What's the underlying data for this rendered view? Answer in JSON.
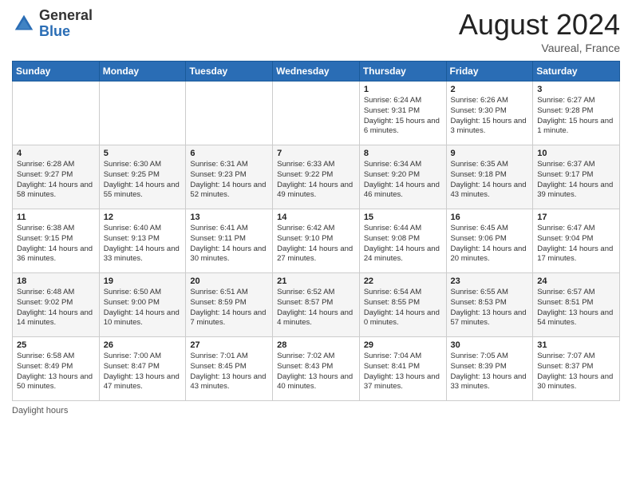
{
  "header": {
    "logo": {
      "general": "General",
      "blue": "Blue"
    },
    "title": "August 2024",
    "location": "Vaureal, France"
  },
  "calendar": {
    "days_of_week": [
      "Sunday",
      "Monday",
      "Tuesday",
      "Wednesday",
      "Thursday",
      "Friday",
      "Saturday"
    ],
    "weeks": [
      [
        {
          "day": "",
          "info": ""
        },
        {
          "day": "",
          "info": ""
        },
        {
          "day": "",
          "info": ""
        },
        {
          "day": "",
          "info": ""
        },
        {
          "day": "1",
          "info": "Sunrise: 6:24 AM\nSunset: 9:31 PM\nDaylight: 15 hours and 6 minutes."
        },
        {
          "day": "2",
          "info": "Sunrise: 6:26 AM\nSunset: 9:30 PM\nDaylight: 15 hours and 3 minutes."
        },
        {
          "day": "3",
          "info": "Sunrise: 6:27 AM\nSunset: 9:28 PM\nDaylight: 15 hours and 1 minute."
        }
      ],
      [
        {
          "day": "4",
          "info": "Sunrise: 6:28 AM\nSunset: 9:27 PM\nDaylight: 14 hours and 58 minutes."
        },
        {
          "day": "5",
          "info": "Sunrise: 6:30 AM\nSunset: 9:25 PM\nDaylight: 14 hours and 55 minutes."
        },
        {
          "day": "6",
          "info": "Sunrise: 6:31 AM\nSunset: 9:23 PM\nDaylight: 14 hours and 52 minutes."
        },
        {
          "day": "7",
          "info": "Sunrise: 6:33 AM\nSunset: 9:22 PM\nDaylight: 14 hours and 49 minutes."
        },
        {
          "day": "8",
          "info": "Sunrise: 6:34 AM\nSunset: 9:20 PM\nDaylight: 14 hours and 46 minutes."
        },
        {
          "day": "9",
          "info": "Sunrise: 6:35 AM\nSunset: 9:18 PM\nDaylight: 14 hours and 43 minutes."
        },
        {
          "day": "10",
          "info": "Sunrise: 6:37 AM\nSunset: 9:17 PM\nDaylight: 14 hours and 39 minutes."
        }
      ],
      [
        {
          "day": "11",
          "info": "Sunrise: 6:38 AM\nSunset: 9:15 PM\nDaylight: 14 hours and 36 minutes."
        },
        {
          "day": "12",
          "info": "Sunrise: 6:40 AM\nSunset: 9:13 PM\nDaylight: 14 hours and 33 minutes."
        },
        {
          "day": "13",
          "info": "Sunrise: 6:41 AM\nSunset: 9:11 PM\nDaylight: 14 hours and 30 minutes."
        },
        {
          "day": "14",
          "info": "Sunrise: 6:42 AM\nSunset: 9:10 PM\nDaylight: 14 hours and 27 minutes."
        },
        {
          "day": "15",
          "info": "Sunrise: 6:44 AM\nSunset: 9:08 PM\nDaylight: 14 hours and 24 minutes."
        },
        {
          "day": "16",
          "info": "Sunrise: 6:45 AM\nSunset: 9:06 PM\nDaylight: 14 hours and 20 minutes."
        },
        {
          "day": "17",
          "info": "Sunrise: 6:47 AM\nSunset: 9:04 PM\nDaylight: 14 hours and 17 minutes."
        }
      ],
      [
        {
          "day": "18",
          "info": "Sunrise: 6:48 AM\nSunset: 9:02 PM\nDaylight: 14 hours and 14 minutes."
        },
        {
          "day": "19",
          "info": "Sunrise: 6:50 AM\nSunset: 9:00 PM\nDaylight: 14 hours and 10 minutes."
        },
        {
          "day": "20",
          "info": "Sunrise: 6:51 AM\nSunset: 8:59 PM\nDaylight: 14 hours and 7 minutes."
        },
        {
          "day": "21",
          "info": "Sunrise: 6:52 AM\nSunset: 8:57 PM\nDaylight: 14 hours and 4 minutes."
        },
        {
          "day": "22",
          "info": "Sunrise: 6:54 AM\nSunset: 8:55 PM\nDaylight: 14 hours and 0 minutes."
        },
        {
          "day": "23",
          "info": "Sunrise: 6:55 AM\nSunset: 8:53 PM\nDaylight: 13 hours and 57 minutes."
        },
        {
          "day": "24",
          "info": "Sunrise: 6:57 AM\nSunset: 8:51 PM\nDaylight: 13 hours and 54 minutes."
        }
      ],
      [
        {
          "day": "25",
          "info": "Sunrise: 6:58 AM\nSunset: 8:49 PM\nDaylight: 13 hours and 50 minutes."
        },
        {
          "day": "26",
          "info": "Sunrise: 7:00 AM\nSunset: 8:47 PM\nDaylight: 13 hours and 47 minutes."
        },
        {
          "day": "27",
          "info": "Sunrise: 7:01 AM\nSunset: 8:45 PM\nDaylight: 13 hours and 43 minutes."
        },
        {
          "day": "28",
          "info": "Sunrise: 7:02 AM\nSunset: 8:43 PM\nDaylight: 13 hours and 40 minutes."
        },
        {
          "day": "29",
          "info": "Sunrise: 7:04 AM\nSunset: 8:41 PM\nDaylight: 13 hours and 37 minutes."
        },
        {
          "day": "30",
          "info": "Sunrise: 7:05 AM\nSunset: 8:39 PM\nDaylight: 13 hours and 33 minutes."
        },
        {
          "day": "31",
          "info": "Sunrise: 7:07 AM\nSunset: 8:37 PM\nDaylight: 13 hours and 30 minutes."
        }
      ]
    ]
  },
  "footer": {
    "note": "Daylight hours"
  }
}
